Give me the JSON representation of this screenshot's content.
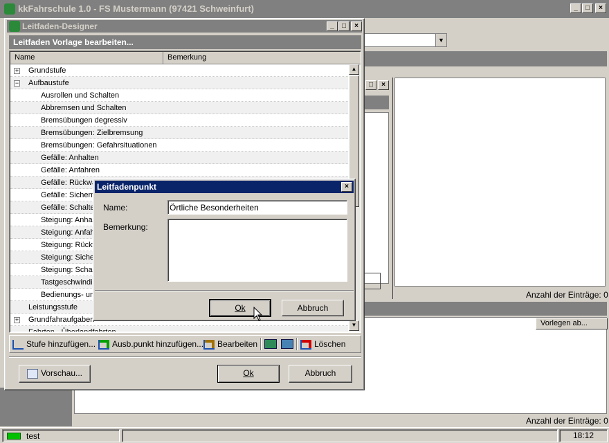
{
  "main_window": {
    "title": "kkFahrschule 1.0 - FS Mustermann (97421 Schweinfurt)"
  },
  "designer": {
    "title": "Leitfaden-Designer",
    "header": "Leitfaden Vorlage bearbeiten...",
    "col_name": "Name",
    "col_bemerkung": "Bemerkung",
    "tree": [
      {
        "label": "Grundstufe",
        "level": 0,
        "expander": "+"
      },
      {
        "label": "Aufbaustufe",
        "level": 0,
        "expander": "−"
      },
      {
        "label": "Ausrollen und Schalten",
        "level": 1
      },
      {
        "label": "Abbremsen und Schalten",
        "level": 1
      },
      {
        "label": "Bremsübungen degressiv",
        "level": 1
      },
      {
        "label": "Bremsübungen: Zielbremsung",
        "level": 1
      },
      {
        "label": "Bremsübungen: Gefahrsituationen",
        "level": 1
      },
      {
        "label": "Gefälle: Anhalten",
        "level": 1
      },
      {
        "label": "Gefälle: Anfahren",
        "level": 1
      },
      {
        "label": "Gefälle: Rückwä",
        "level": 1
      },
      {
        "label": "Gefälle: Sichern",
        "level": 1
      },
      {
        "label": "Gefälle: Schalte",
        "level": 1
      },
      {
        "label": "Steigung: Anhal",
        "level": 1
      },
      {
        "label": "Steigung: Anfah",
        "level": 1
      },
      {
        "label": "Steigung: Rückw",
        "level": 1
      },
      {
        "label": "Steigung: Siche",
        "level": 1
      },
      {
        "label": "Steigung: Schal",
        "level": 1
      },
      {
        "label": "Tastgeschwindig",
        "level": 1
      },
      {
        "label": "Bedienungs- un",
        "level": 1
      },
      {
        "label": "Leistungsstufe",
        "level": 0
      },
      {
        "label": "Grundfahraufgaben",
        "level": 0,
        "expander": "+"
      },
      {
        "label": "Fahrten - Überlandfahrten",
        "level": 0
      }
    ],
    "toolbar": {
      "add_stage": "Stufe hinzufügen...",
      "add_point": "Ausb.punkt hinzufügen...",
      "edit": "Bearbeiten",
      "delete": "Löschen"
    },
    "preview_btn": "Vorschau...",
    "ok_btn": "Ok",
    "cancel_btn": "Abbruch"
  },
  "dialog": {
    "title": "Leitfadenpunkt",
    "name_label": "Name:",
    "name_value": "Örtliche Besonderheiten",
    "remark_label": "Bemerkung:",
    "ok": "Ok",
    "cancel": "Abbruch"
  },
  "background": {
    "count1": "Anzahl der Einträge: 0",
    "count2": "Anzahl der Einträge: 0",
    "vorlegen": "Vorlegen ab..."
  },
  "statusbar": {
    "text": "test",
    "time": "18:12"
  }
}
